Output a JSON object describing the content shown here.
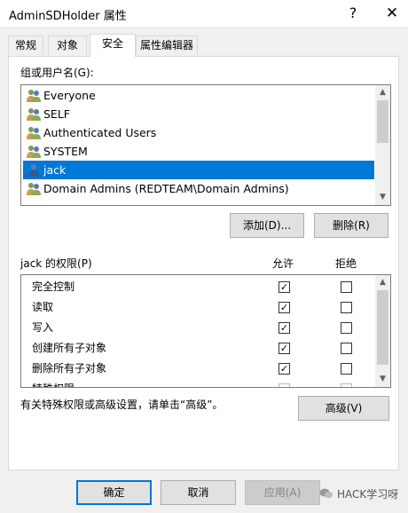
{
  "window": {
    "title": "AdminSDHolder 属性",
    "help_glyph": "?",
    "close_glyph": "✕"
  },
  "tabs": [
    {
      "label": "常规",
      "active": false
    },
    {
      "label": "对象",
      "active": false
    },
    {
      "label": "安全",
      "active": true
    },
    {
      "label": "属性编辑器",
      "active": false
    }
  ],
  "security": {
    "groups_label": "组或用户名(G):",
    "users": [
      {
        "name": "Everyone",
        "icon": "group-icon"
      },
      {
        "name": "SELF",
        "icon": "group-icon"
      },
      {
        "name": "Authenticated Users",
        "icon": "group-icon"
      },
      {
        "name": "SYSTEM",
        "icon": "group-icon"
      },
      {
        "name": "jack",
        "icon": "user-icon",
        "selected": true
      },
      {
        "name": "Domain Admins (REDTEAM\\Domain Admins)",
        "icon": "group-icon"
      }
    ],
    "add_button": "添加(D)...",
    "remove_button": "删除(R)",
    "permissions_label": "jack 的权限(P)",
    "allow_header": "允许",
    "deny_header": "拒绝",
    "permissions": [
      {
        "name": "完全控制",
        "allow": true,
        "deny": false
      },
      {
        "name": "读取",
        "allow": true,
        "deny": false
      },
      {
        "name": "写入",
        "allow": true,
        "deny": false
      },
      {
        "name": "创建所有子对象",
        "allow": true,
        "deny": false
      },
      {
        "name": "删除所有子对象",
        "allow": true,
        "deny": false
      },
      {
        "name": "特殊权限",
        "allow": false,
        "deny": false
      }
    ],
    "advanced_note": "有关特殊权限或高级设置，请单击“高级”。",
    "advanced_button": "高级(V)"
  },
  "footer": {
    "ok_button": "确定",
    "cancel_button": "取消",
    "apply_button": "应用(A)"
  },
  "watermark": "HACK学习呀",
  "colors": {
    "selection": "#0078d7",
    "dialog_bg": "#f0f0f0"
  }
}
